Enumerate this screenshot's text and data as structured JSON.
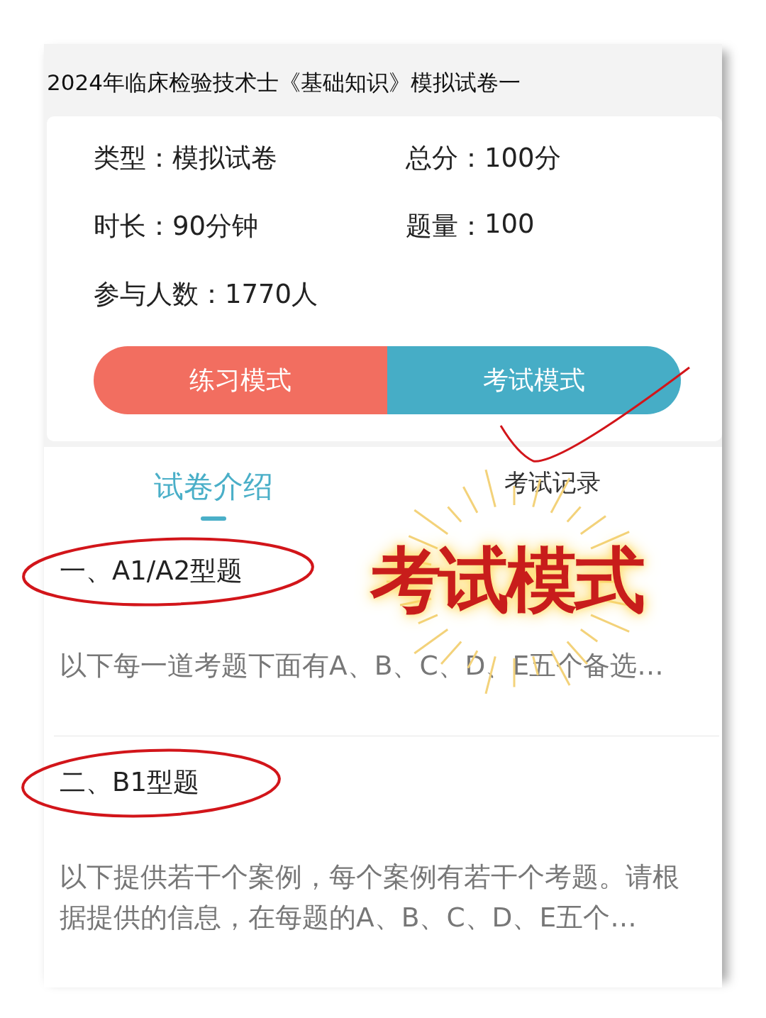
{
  "title": "2024年临床检验技术士《基础知识》模拟试卷一",
  "info": [
    {
      "label": "类型：",
      "value": "模拟试卷"
    },
    {
      "label": "总分：",
      "value": "100分"
    },
    {
      "label": "时长：",
      "value": "90分钟"
    },
    {
      "label": "题量：",
      "value": "100"
    },
    {
      "label": "参与人数：",
      "value": "1770人"
    }
  ],
  "mode_buttons": [
    {
      "label": "练习模式",
      "kind": "practice"
    },
    {
      "label": "考试模式",
      "kind": "exam",
      "ticked": true
    }
  ],
  "tabs": [
    {
      "label": "试卷介绍",
      "selected": true
    },
    {
      "label": "考试记录",
      "selected": false
    }
  ],
  "sections": [
    {
      "heading": "一、A1/A2型题",
      "description": "以下每一道考题下面有A、B、C、D、E五个备选…",
      "circled": true
    },
    {
      "heading": "二、B1型题",
      "description": "以下提供若干个案例，每个案例有若干个考题。请根据提供的信息，在每题的A、B、C、D、E五个…",
      "circled": true
    }
  ],
  "stamp": "考试模式"
}
